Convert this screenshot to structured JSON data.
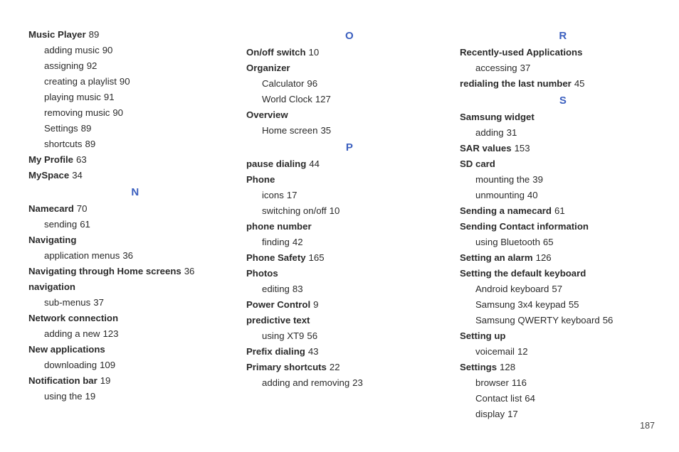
{
  "page_number": "187",
  "columns": [
    {
      "id": "col1",
      "items": [
        {
          "type": "entry",
          "bold": true,
          "term": "Music Player",
          "page": "89"
        },
        {
          "type": "sub",
          "term": "adding music",
          "page": "90"
        },
        {
          "type": "sub",
          "term": "assigning",
          "page": "92"
        },
        {
          "type": "sub",
          "term": "creating a playlist",
          "page": "90"
        },
        {
          "type": "sub",
          "term": "playing music",
          "page": "91"
        },
        {
          "type": "sub",
          "term": "removing music",
          "page": "90"
        },
        {
          "type": "sub",
          "term": "Settings",
          "page": "89"
        },
        {
          "type": "sub",
          "term": "shortcuts",
          "page": "89"
        },
        {
          "type": "entry",
          "bold": true,
          "term": "My Profile",
          "page": "63"
        },
        {
          "type": "entry",
          "bold": true,
          "term": "MySpace",
          "page": "34"
        },
        {
          "type": "letter",
          "letter": "N"
        },
        {
          "type": "entry",
          "bold": true,
          "term": "Namecard",
          "page": "70"
        },
        {
          "type": "sub",
          "term": "sending",
          "page": "61"
        },
        {
          "type": "entry",
          "bold": true,
          "term": "Navigating",
          "page": ""
        },
        {
          "type": "sub",
          "term": "application menus",
          "page": "36"
        },
        {
          "type": "entry",
          "bold": true,
          "term": "Navigating through Home screens",
          "page": "36"
        },
        {
          "type": "entry",
          "bold": true,
          "term": "navigation",
          "page": ""
        },
        {
          "type": "sub",
          "term": "sub-menus",
          "page": "37"
        },
        {
          "type": "entry",
          "bold": true,
          "term": "Network connection",
          "page": ""
        },
        {
          "type": "sub",
          "term": "adding a new",
          "page": "123"
        },
        {
          "type": "entry",
          "bold": true,
          "term": "New applications",
          "page": ""
        },
        {
          "type": "sub",
          "term": "downloading",
          "page": "109"
        },
        {
          "type": "entry",
          "bold": true,
          "term": "Notification bar",
          "page": "19"
        },
        {
          "type": "sub",
          "term": "using the",
          "page": "19"
        }
      ]
    },
    {
      "id": "col2",
      "items": [
        {
          "type": "letter",
          "letter": "O"
        },
        {
          "type": "entry",
          "bold": true,
          "term": "On/off switch",
          "page": "10"
        },
        {
          "type": "entry",
          "bold": true,
          "term": "Organizer",
          "page": ""
        },
        {
          "type": "sub",
          "term": "Calculator",
          "page": "96"
        },
        {
          "type": "sub",
          "term": "World Clock",
          "page": "127"
        },
        {
          "type": "entry",
          "bold": true,
          "term": "Overview",
          "page": ""
        },
        {
          "type": "sub",
          "term": "Home screen",
          "page": "35"
        },
        {
          "type": "letter",
          "letter": "P"
        },
        {
          "type": "entry",
          "bold": true,
          "term": "pause dialing",
          "page": "44"
        },
        {
          "type": "entry",
          "bold": true,
          "term": "Phone",
          "page": ""
        },
        {
          "type": "sub",
          "term": "icons",
          "page": "17"
        },
        {
          "type": "sub",
          "term": "switching on/off",
          "page": "10"
        },
        {
          "type": "entry",
          "bold": true,
          "term": "phone number",
          "page": ""
        },
        {
          "type": "sub",
          "term": "finding",
          "page": "42"
        },
        {
          "type": "entry",
          "bold": true,
          "term": "Phone Safety",
          "page": "165"
        },
        {
          "type": "entry",
          "bold": true,
          "term": "Photos",
          "page": ""
        },
        {
          "type": "sub",
          "term": "editing",
          "page": "83"
        },
        {
          "type": "entry",
          "bold": true,
          "term": "Power Control",
          "page": "9"
        },
        {
          "type": "entry",
          "bold": true,
          "term": "predictive text",
          "page": ""
        },
        {
          "type": "sub",
          "term": "using XT9",
          "page": "56"
        },
        {
          "type": "entry",
          "bold": true,
          "term": "Prefix dialing",
          "page": "43"
        },
        {
          "type": "entry",
          "bold": true,
          "term": "Primary shortcuts",
          "page": "22"
        },
        {
          "type": "sub",
          "term": "adding and removing",
          "page": "23"
        }
      ]
    },
    {
      "id": "col3",
      "items": [
        {
          "type": "letter",
          "letter": "R"
        },
        {
          "type": "entry",
          "bold": true,
          "term": "Recently-used Applications",
          "page": ""
        },
        {
          "type": "sub",
          "term": "accessing",
          "page": "37"
        },
        {
          "type": "entry",
          "bold": true,
          "term": "redialing the last number",
          "page": "45"
        },
        {
          "type": "letter",
          "letter": "S"
        },
        {
          "type": "entry",
          "bold": true,
          "term": "Samsung widget",
          "page": ""
        },
        {
          "type": "sub",
          "term": "adding",
          "page": "31"
        },
        {
          "type": "entry",
          "bold": true,
          "term": "SAR values",
          "page": "153"
        },
        {
          "type": "entry",
          "bold": true,
          "term": "SD card",
          "page": ""
        },
        {
          "type": "sub",
          "term": "mounting the",
          "page": "39"
        },
        {
          "type": "sub",
          "term": "unmounting",
          "page": "40"
        },
        {
          "type": "entry",
          "bold": true,
          "term": "Sending a namecard",
          "page": "61"
        },
        {
          "type": "entry",
          "bold": true,
          "term": "Sending Contact information",
          "page": ""
        },
        {
          "type": "sub",
          "term": "using Bluetooth",
          "page": "65"
        },
        {
          "type": "entry",
          "bold": true,
          "term": "Setting an alarm",
          "page": "126"
        },
        {
          "type": "entry",
          "bold": true,
          "term": "Setting the default keyboard",
          "page": ""
        },
        {
          "type": "sub",
          "term": "Android keyboard",
          "page": "57"
        },
        {
          "type": "sub",
          "term": "Samsung 3x4 keypad",
          "page": "55"
        },
        {
          "type": "sub",
          "term": "Samsung QWERTY keyboard",
          "page": "56"
        },
        {
          "type": "entry",
          "bold": true,
          "term": "Setting up",
          "page": ""
        },
        {
          "type": "sub",
          "term": "voicemail",
          "page": "12"
        },
        {
          "type": "entry",
          "bold": true,
          "term": "Settings",
          "page": "128"
        },
        {
          "type": "sub",
          "term": "browser",
          "page": "116"
        },
        {
          "type": "sub",
          "term": "Contact list",
          "page": "64"
        },
        {
          "type": "sub",
          "term": "display",
          "page": "17"
        }
      ]
    }
  ]
}
